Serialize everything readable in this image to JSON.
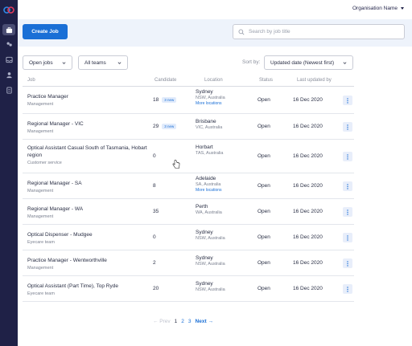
{
  "topbar": {
    "org_label": "Organisation Name"
  },
  "actions": {
    "create_label": "Create Job"
  },
  "search": {
    "placeholder": "Search by job title"
  },
  "filters": {
    "status_value": "Open jobs",
    "team_value": "All teams"
  },
  "sort": {
    "label": "Sort by:",
    "value": "Updated date (Newest first)"
  },
  "table": {
    "headers": {
      "job": "Job",
      "candidate": "Candidate",
      "location": "Location",
      "status": "Status",
      "updated": "Last updated by"
    },
    "rows": [
      {
        "title": "Practice Manager",
        "team": "Management",
        "candidates": "18",
        "badge": "3 new",
        "city": "Sydney",
        "state": "NSW, Australia",
        "more": "More locations",
        "status": "Open",
        "updated": "16 Dec 2020"
      },
      {
        "title": "Regional Manager - VIC",
        "team": "Management",
        "candidates": "29",
        "badge": "3 new",
        "city": "Brisbane",
        "state": "VIC, Australia",
        "more": "",
        "status": "Open",
        "updated": "16 Dec 2020"
      },
      {
        "title": "Optical Assistant Casual South of Tasmania, Hobart region",
        "team": "Customer service",
        "candidates": "0",
        "badge": "",
        "city": "Horbart",
        "state": "TAS, Australia",
        "more": "",
        "status": "Open",
        "updated": "16 Dec 2020"
      },
      {
        "title": "Regional Manager - SA",
        "team": "Management",
        "candidates": "8",
        "badge": "",
        "city": "Adelaide",
        "state": "SA, Australia",
        "more": "More locations",
        "status": "Open",
        "updated": "16 Dec 2020"
      },
      {
        "title": "Regional Manager - WA",
        "team": "Management",
        "candidates": "35",
        "badge": "",
        "city": "Perth",
        "state": "WA, Australia",
        "more": "",
        "status": "Open",
        "updated": "16 Dec 2020"
      },
      {
        "title": "Optical Dispenser - Mudgee",
        "team": "Eyecare team",
        "candidates": "0",
        "badge": "",
        "city": "Sydney",
        "state": "NSW, Australia",
        "more": "",
        "status": "Open",
        "updated": "16 Dec 2020"
      },
      {
        "title": "Practice Manager - Wentworthville",
        "team": "Management",
        "candidates": "2",
        "badge": "",
        "city": "Sydney",
        "state": "NSW, Australia",
        "more": "",
        "status": "Open",
        "updated": "16 Dec 2020"
      },
      {
        "title": "Optical Assistant (Part Time), Top Ryde",
        "team": "Eyecare team",
        "candidates": "20",
        "badge": "",
        "city": "Sydney",
        "state": "NSW, Australia",
        "more": "",
        "status": "Open",
        "updated": "16 Dec 2020"
      }
    ]
  },
  "pagination": {
    "prev": "← Prev",
    "pages": [
      "1",
      "2",
      "3"
    ],
    "current_page": "1",
    "next": "Next →"
  },
  "colors": {
    "sidebar": "#1f2147",
    "accent": "#1a6fd6",
    "actionbar": "#eef3fb"
  },
  "icons": {
    "sidebar": [
      "briefcase-icon",
      "people-icon",
      "inbox-icon",
      "user-icon",
      "document-icon"
    ]
  }
}
